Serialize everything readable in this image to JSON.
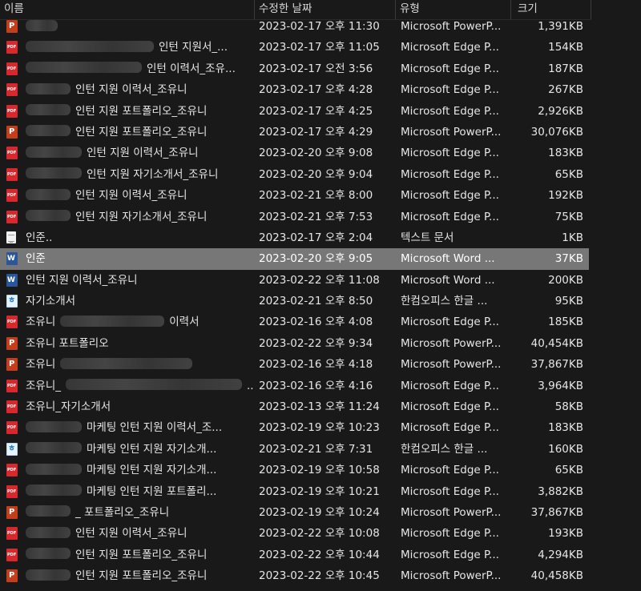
{
  "columns": {
    "name": "이름",
    "date": "수정한 날짜",
    "type": "유형",
    "size": "크기"
  },
  "files": [
    {
      "icon": "ppt",
      "blur": 40,
      "name": "",
      "date": "2023-02-17 오후 11:30",
      "type": "Microsoft PowerP...",
      "size": "1,391KB"
    },
    {
      "icon": "pdf",
      "blur": 160,
      "name": "인턴 지원서_...",
      "date": "2023-02-17 오후 11:05",
      "type": "Microsoft Edge P...",
      "size": "154KB"
    },
    {
      "icon": "pdf",
      "blur": 145,
      "name": "인턴 이력서_조유...",
      "date": "2023-02-17 오전 3:56",
      "type": "Microsoft Edge P...",
      "size": "187KB"
    },
    {
      "icon": "pdf",
      "blur": 56,
      "name": "인턴 지원 이력서_조유니",
      "date": "2023-02-17 오후 4:28",
      "type": "Microsoft Edge P...",
      "size": "267KB"
    },
    {
      "icon": "pdf",
      "blur": 56,
      "name": "인턴 지원 포트폴리오_조유니",
      "date": "2023-02-17 오후 4:25",
      "type": "Microsoft Edge P...",
      "size": "2,926KB"
    },
    {
      "icon": "ppt",
      "blur": 56,
      "name": "인턴 지원 포트폴리오_조유니",
      "date": "2023-02-17 오후 4:29",
      "type": "Microsoft PowerP...",
      "size": "30,076KB"
    },
    {
      "icon": "pdf",
      "blur": 70,
      "name": "인턴 지원 이력서_조유니",
      "date": "2023-02-20 오후 9:08",
      "type": "Microsoft Edge P...",
      "size": "183KB"
    },
    {
      "icon": "pdf",
      "blur": 70,
      "name": "인턴 지원 자기소개서_조유니",
      "date": "2023-02-20 오후 9:04",
      "type": "Microsoft Edge P...",
      "size": "65KB"
    },
    {
      "icon": "pdf",
      "blur": 56,
      "name": "인턴 지원 이력서_조유니",
      "date": "2023-02-21 오후 8:00",
      "type": "Microsoft Edge P...",
      "size": "192KB"
    },
    {
      "icon": "pdf",
      "blur": 56,
      "name": "인턴 지원 자기소개서_조유니",
      "date": "2023-02-21 오후 7:53",
      "type": "Microsoft Edge P...",
      "size": "75KB"
    },
    {
      "icon": "txt",
      "blur": 0,
      "name": "인준..",
      "date": "2023-02-17 오후 2:04",
      "type": "텍스트 문서",
      "size": "1KB"
    },
    {
      "icon": "word",
      "blur": 0,
      "name": "인준",
      "date": "2023-02-20 오후 9:05",
      "type": "Microsoft Word ...",
      "size": "37KB",
      "selected": true
    },
    {
      "icon": "word",
      "blur": 0,
      "name": "인턴 지원 이력서_조유니",
      "date": "2023-02-22 오후 11:08",
      "type": "Microsoft Word ...",
      "size": "200KB"
    },
    {
      "icon": "hwp",
      "blur": 0,
      "name": "자기소개서",
      "date": "2023-02-21 오후 8:50",
      "type": "한컴오피스 한글 ...",
      "size": "95KB"
    },
    {
      "icon": "pdf",
      "blur": 0,
      "name": "조유니",
      "blur_after": 130,
      "name_after": "이력서",
      "date": "2023-02-16 오후 4:08",
      "type": "Microsoft Edge P...",
      "size": "185KB"
    },
    {
      "icon": "ppt",
      "blur": 0,
      "name": "조유니 포트폴리오",
      "date": "2023-02-22 오후 9:34",
      "type": "Microsoft PowerP...",
      "size": "40,454KB"
    },
    {
      "icon": "ppt",
      "blur": 0,
      "name": "조유니",
      "blur_after": 165,
      "name_after": "",
      "date": "2023-02-16 오후 4:18",
      "type": "Microsoft PowerP...",
      "size": "37,867KB"
    },
    {
      "icon": "pdf",
      "blur": 0,
      "name": "조유니_",
      "blur_after": 220,
      "name_after": "...",
      "date": "2023-02-16 오후 4:16",
      "type": "Microsoft Edge P...",
      "size": "3,964KB"
    },
    {
      "icon": "pdf",
      "blur": 0,
      "name": "조유니_자기소개서",
      "date": "2023-02-13 오후 11:24",
      "type": "Microsoft Edge P...",
      "size": "58KB"
    },
    {
      "icon": "pdf",
      "blur": 70,
      "name": "마케팅 인턴 지원 이력서_조...",
      "date": "2023-02-19 오후 10:23",
      "type": "Microsoft Edge P...",
      "size": "183KB"
    },
    {
      "icon": "hwp",
      "blur": 70,
      "name": "마케팅 인턴 지원 자기소개...",
      "date": "2023-02-21 오후 7:31",
      "type": "한컴오피스 한글 ...",
      "size": "160KB"
    },
    {
      "icon": "pdf",
      "blur": 70,
      "name": "마케팅 인턴 지원 자기소개...",
      "date": "2023-02-19 오후 10:58",
      "type": "Microsoft Edge P...",
      "size": "65KB"
    },
    {
      "icon": "pdf",
      "blur": 70,
      "name": "마케팅 인턴 지원 포트폴리...",
      "date": "2023-02-19 오후 10:21",
      "type": "Microsoft Edge P...",
      "size": "3,882KB"
    },
    {
      "icon": "ppt",
      "blur": 56,
      "name": "_ 포트폴리오_조유니",
      "date": "2023-02-19 오후 10:24",
      "type": "Microsoft PowerP...",
      "size": "37,867KB"
    },
    {
      "icon": "pdf",
      "blur": 56,
      "name": "인턴 지원 이력서_조유니",
      "date": "2023-02-22 오후 10:08",
      "type": "Microsoft Edge P...",
      "size": "193KB"
    },
    {
      "icon": "pdf",
      "blur": 56,
      "name": "인턴 지원 포트폴리오_조유니",
      "date": "2023-02-22 오후 10:44",
      "type": "Microsoft Edge P...",
      "size": "4,294KB"
    },
    {
      "icon": "ppt",
      "blur": 56,
      "name": "인턴 지원 포트폴리오_조유니",
      "date": "2023-02-22 오후 10:45",
      "type": "Microsoft PowerP...",
      "size": "40,458KB"
    }
  ]
}
